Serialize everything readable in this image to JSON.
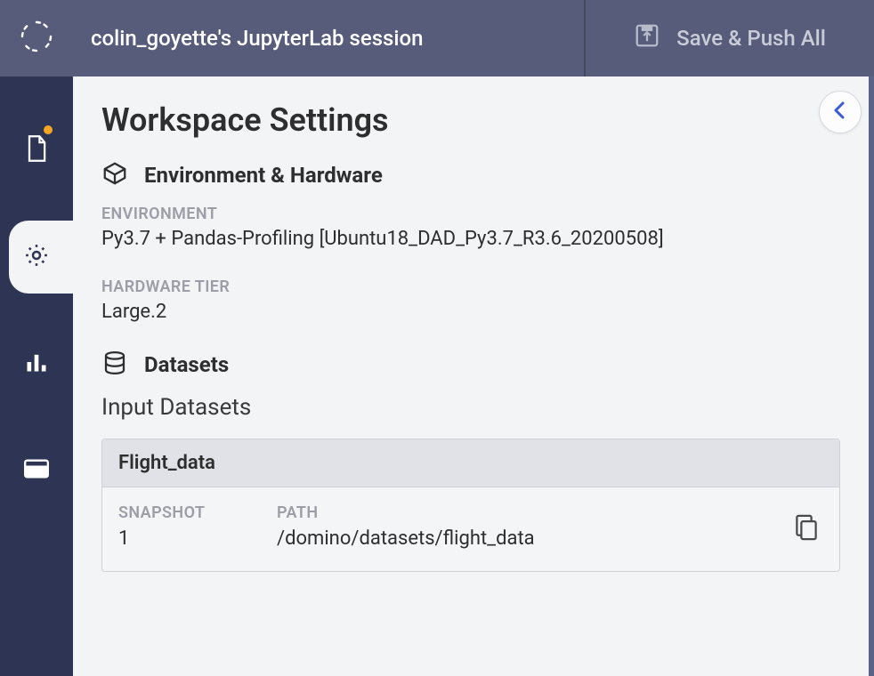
{
  "header": {
    "title": "colin_goyette's JupyterLab session",
    "save_push_label": "Save & Push All"
  },
  "page": {
    "title": "Workspace Settings"
  },
  "sections": {
    "env_hw": {
      "title": "Environment & Hardware",
      "environment_label": "ENVIRONMENT",
      "environment_value": "Py3.7 + Pandas-Profiling [Ubuntu18_DAD_Py3.7_R3.6_20200508]",
      "hardware_label": "HARDWARE TIER",
      "hardware_value": "Large.2"
    },
    "datasets": {
      "title": "Datasets",
      "input_title": "Input Datasets",
      "items": [
        {
          "name": "Flight_data",
          "snapshot_label": "SNAPSHOT",
          "snapshot_value": "1",
          "path_label": "PATH",
          "path_value": "/domino/datasets/flight_data"
        }
      ]
    }
  }
}
